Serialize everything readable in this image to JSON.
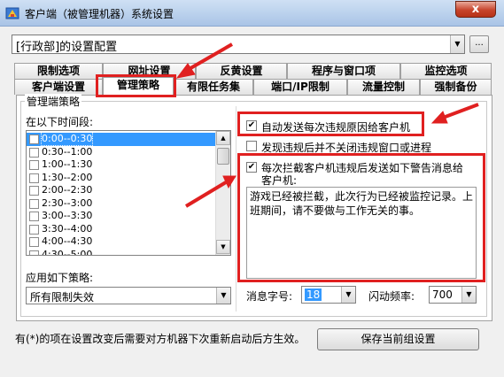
{
  "window": {
    "title": "客户端（被管理机器）系统设置",
    "close_label": "x"
  },
  "config": {
    "value": "[行政部]的设置配置",
    "more_label": "..."
  },
  "tabs_row1": [
    "限制选项",
    "网址设置",
    "反黄设置",
    "程序与窗口项",
    "监控选项"
  ],
  "tabs_row2": [
    "客户端设置",
    "管理策略",
    "有限任务集",
    "端口/IP限制",
    "流量控制",
    "强制备份"
  ],
  "active_tab": "管理策略",
  "group_title": "管理端策略",
  "time_label": "在以下时间段:",
  "time_slots": [
    "0:00--0:30",
    "0:30--1:00",
    "1:00--1:30",
    "1:30--2:00",
    "2:00--2:30",
    "2:30--3:00",
    "3:00--3:30",
    "3:30--4:00",
    "4:00--4:30",
    "4:30--5:00"
  ],
  "policy_label": "应用如下策略:",
  "policy_value": "所有限制失效",
  "options": {
    "auto_send": {
      "label": "自动发送每次违规原因给客户机",
      "checked": true
    },
    "no_close": {
      "label": "发现违规后并不关闭违规窗口或进程",
      "checked": false
    },
    "send_warning": {
      "label_line1": "每次拦截客户机违规后发送如下警告消息给",
      "label_line2": "客户机:",
      "checked": true
    }
  },
  "warning_message": "游戏已经被拦截，此次行为已经被监控记录。上班期间，请不要做与工作无关的事。",
  "font_size_label": "消息字号:",
  "font_size_value": "18",
  "flash_label": "闪动频率:",
  "flash_value": "700",
  "footer_note": "有(*)的项在设置改变后需要对方机器下次重新启动后方生效。",
  "save_label": "保存当前组设置",
  "colors": {
    "highlight_red": "#e02020",
    "selection_blue": "#3399ff"
  }
}
